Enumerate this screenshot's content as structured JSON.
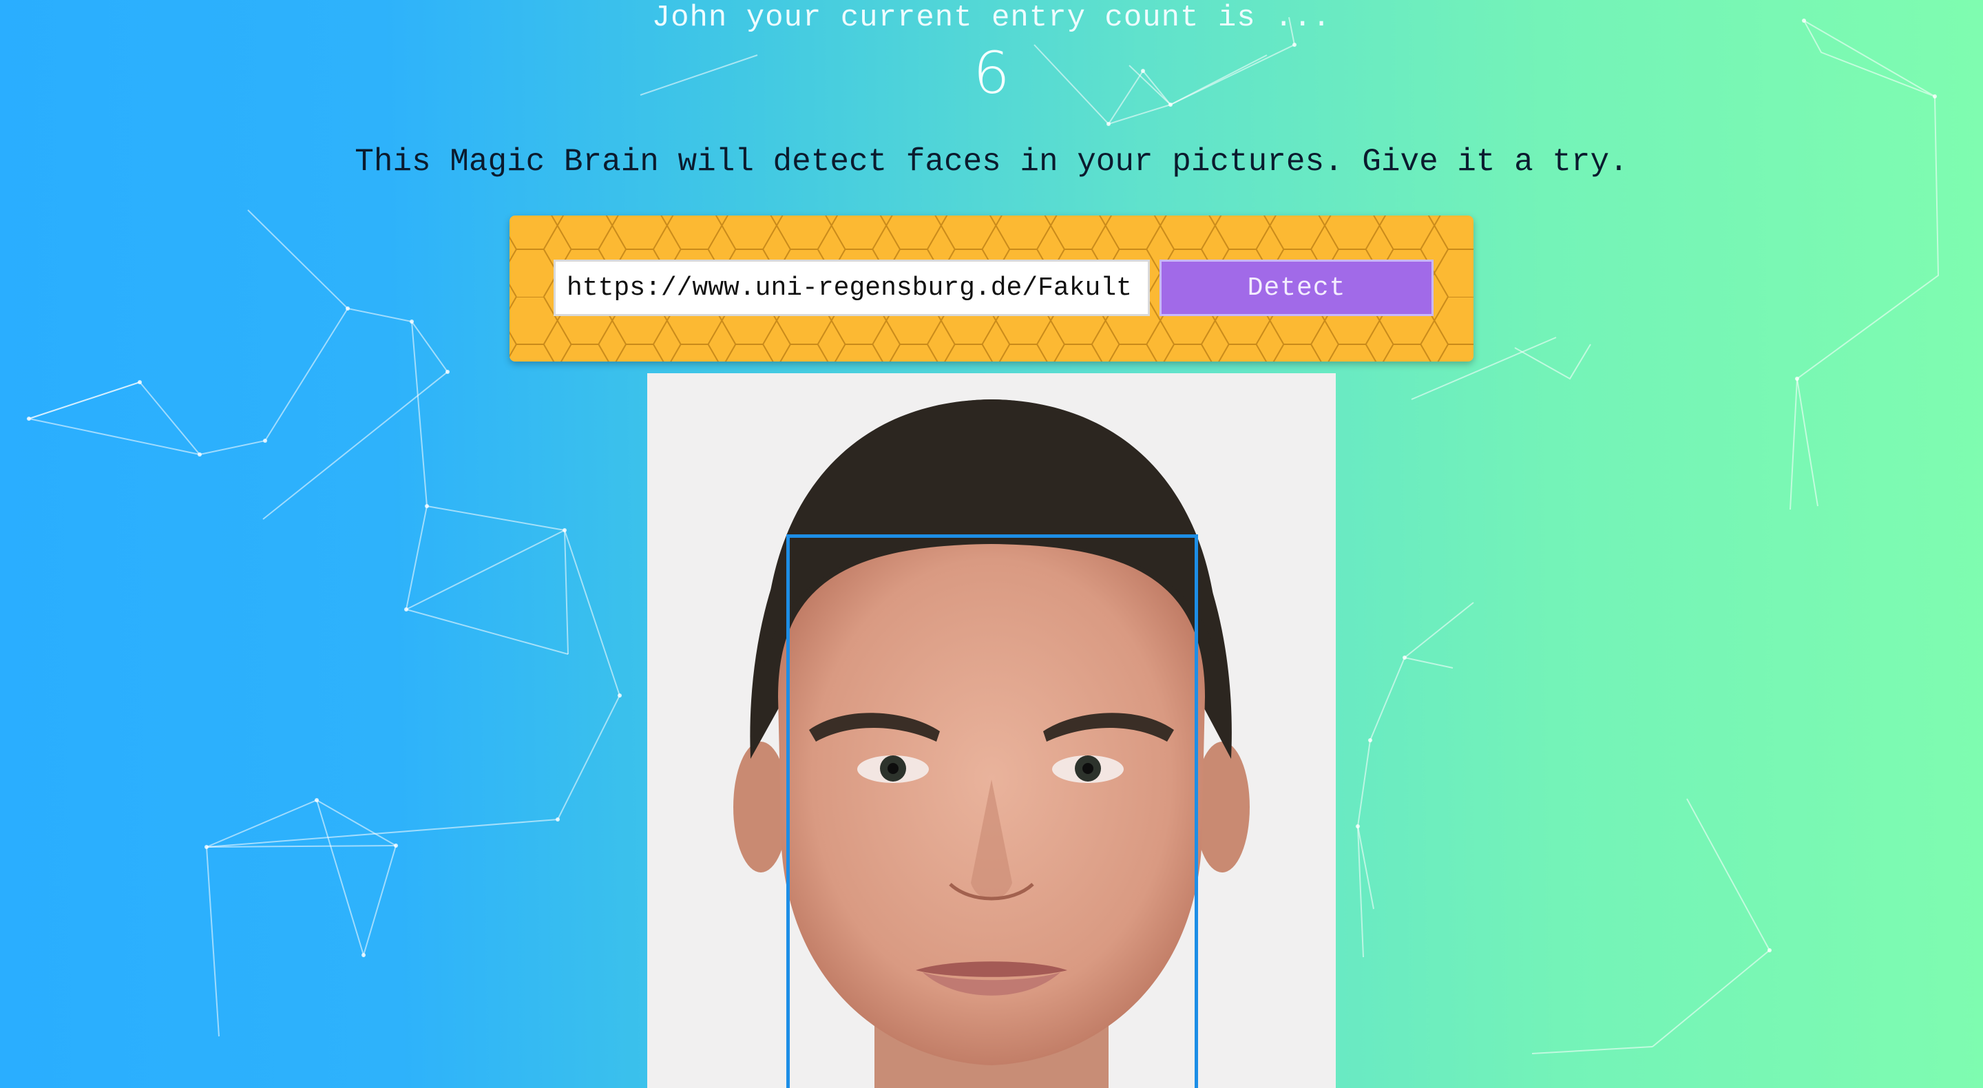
{
  "greeting": {
    "text": "John your current entry count is ...",
    "count": "6"
  },
  "tagline": "This Magic Brain will detect faces in your pictures. Give it a try.",
  "form": {
    "input_value": "https://www.uni-regensburg.de/Fakult",
    "input_placeholder": "",
    "detect_label": "Detect"
  },
  "image": {
    "subject": "portrait of a man with short dark hair",
    "face_detected": true
  },
  "colors": {
    "background_start": "#2aaeff",
    "background_end": "#7ffcb0",
    "panel": "#fcb933",
    "button": "#a16ae8",
    "face_box": "#1d8ee6"
  }
}
